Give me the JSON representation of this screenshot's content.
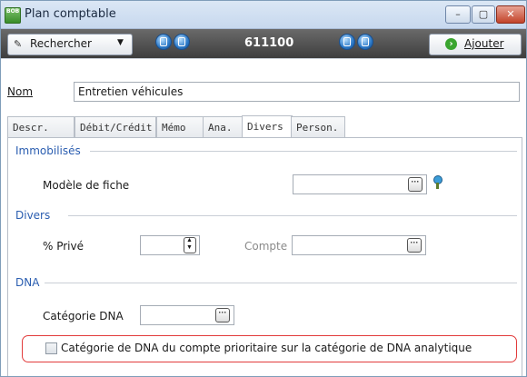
{
  "window": {
    "title": "Plan comptable",
    "app_icon_text": "BOB",
    "buttons": [
      "minimize",
      "maximize",
      "close"
    ]
  },
  "toolbar": {
    "search_label": "Rechercher",
    "account_code": "611100",
    "add_label": "Ajouter"
  },
  "nom": {
    "label": "Nom",
    "value": "Entretien véhicules"
  },
  "tabs": [
    "Descr.",
    "Débit/Crédit",
    "Mémo",
    "Ana.",
    "Divers",
    "Person."
  ],
  "active_tab": "Divers",
  "sections": {
    "immobilises": {
      "title": "Immobilisés",
      "modele_label": "Modèle de fiche"
    },
    "divers": {
      "title": "Divers",
      "prive_label": "% Privé",
      "compte_label": "Compte"
    },
    "dna": {
      "title": "DNA",
      "categorie_label": "Catégorie DNA",
      "checkbox_label": "Catégorie de DNA du compte prioritaire sur la catégorie de DNA analytique",
      "checkbox_checked": false
    }
  },
  "colors": {
    "section_title": "#2a5db0",
    "highlight_border": "#e23b3b",
    "code_bar": "#4a4a4a"
  }
}
